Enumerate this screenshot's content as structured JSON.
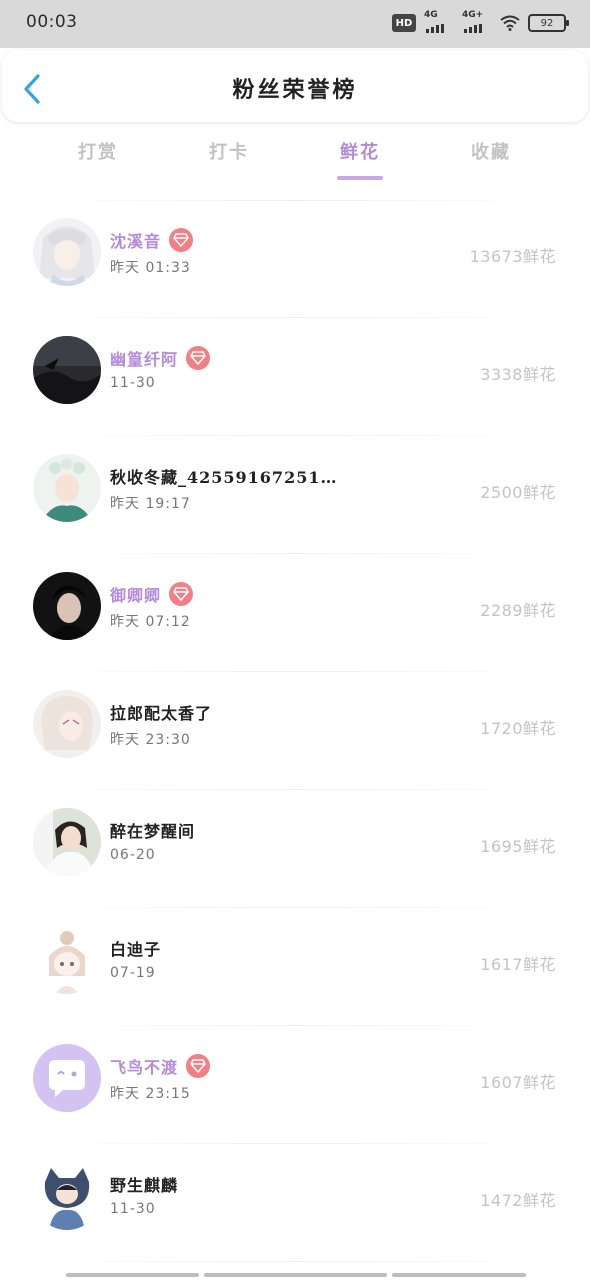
{
  "status_bar": {
    "time": "00:03",
    "hd_label": "HD",
    "hd_sub": "1 2",
    "net1": "4G",
    "net2": "4G+",
    "battery": "92"
  },
  "header": {
    "back_icon": "chevron-left-icon",
    "title": "粉丝荣誉榜"
  },
  "tabs": [
    {
      "label": "打赏",
      "active": false
    },
    {
      "label": "打卡",
      "active": false
    },
    {
      "label": "鲜花",
      "active": true
    },
    {
      "label": "收藏",
      "active": false
    }
  ],
  "colors": {
    "accent": "#b48bd8",
    "vip_badge": "#f07f86",
    "value_text": "#c4c4c4"
  },
  "fans": [
    {
      "name": "沈溪音",
      "vip": true,
      "date": "昨天 01:33",
      "value": "13673鲜花",
      "avatar": "anime-white-hair-avatar"
    },
    {
      "name": "幽篁纤阿",
      "vip": true,
      "date": "11-30",
      "value": "3338鲜花",
      "avatar": "dark-landscape-avatar"
    },
    {
      "name": "秋收冬藏_42559167251…",
      "vip": false,
      "date": "昨天 19:17",
      "value": "2500鲜花",
      "avatar": "flower-crown-avatar"
    },
    {
      "name": "御卿卿",
      "vip": true,
      "date": "昨天 07:12",
      "value": "2289鲜花",
      "avatar": "dark-portrait-avatar"
    },
    {
      "name": "拉郎配太香了",
      "vip": false,
      "date": "昨天 23:30",
      "value": "1720鲜花",
      "avatar": "pale-anime-avatar"
    },
    {
      "name": "醉在梦醒间",
      "vip": false,
      "date": "06-20",
      "value": "1695鲜花",
      "avatar": "bride-photo-avatar"
    },
    {
      "name": "白迪子",
      "vip": false,
      "date": "07-19",
      "value": "1617鲜花",
      "avatar": "chibi-girl-avatar"
    },
    {
      "name": "飞鸟不渡",
      "vip": true,
      "date": "昨天 23:15",
      "value": "1607鲜花",
      "avatar": "default-chat-avatar"
    },
    {
      "name": "野生麒麟",
      "vip": false,
      "date": "11-30",
      "value": "1472鲜花",
      "avatar": "cat-hood-boy-avatar"
    }
  ]
}
